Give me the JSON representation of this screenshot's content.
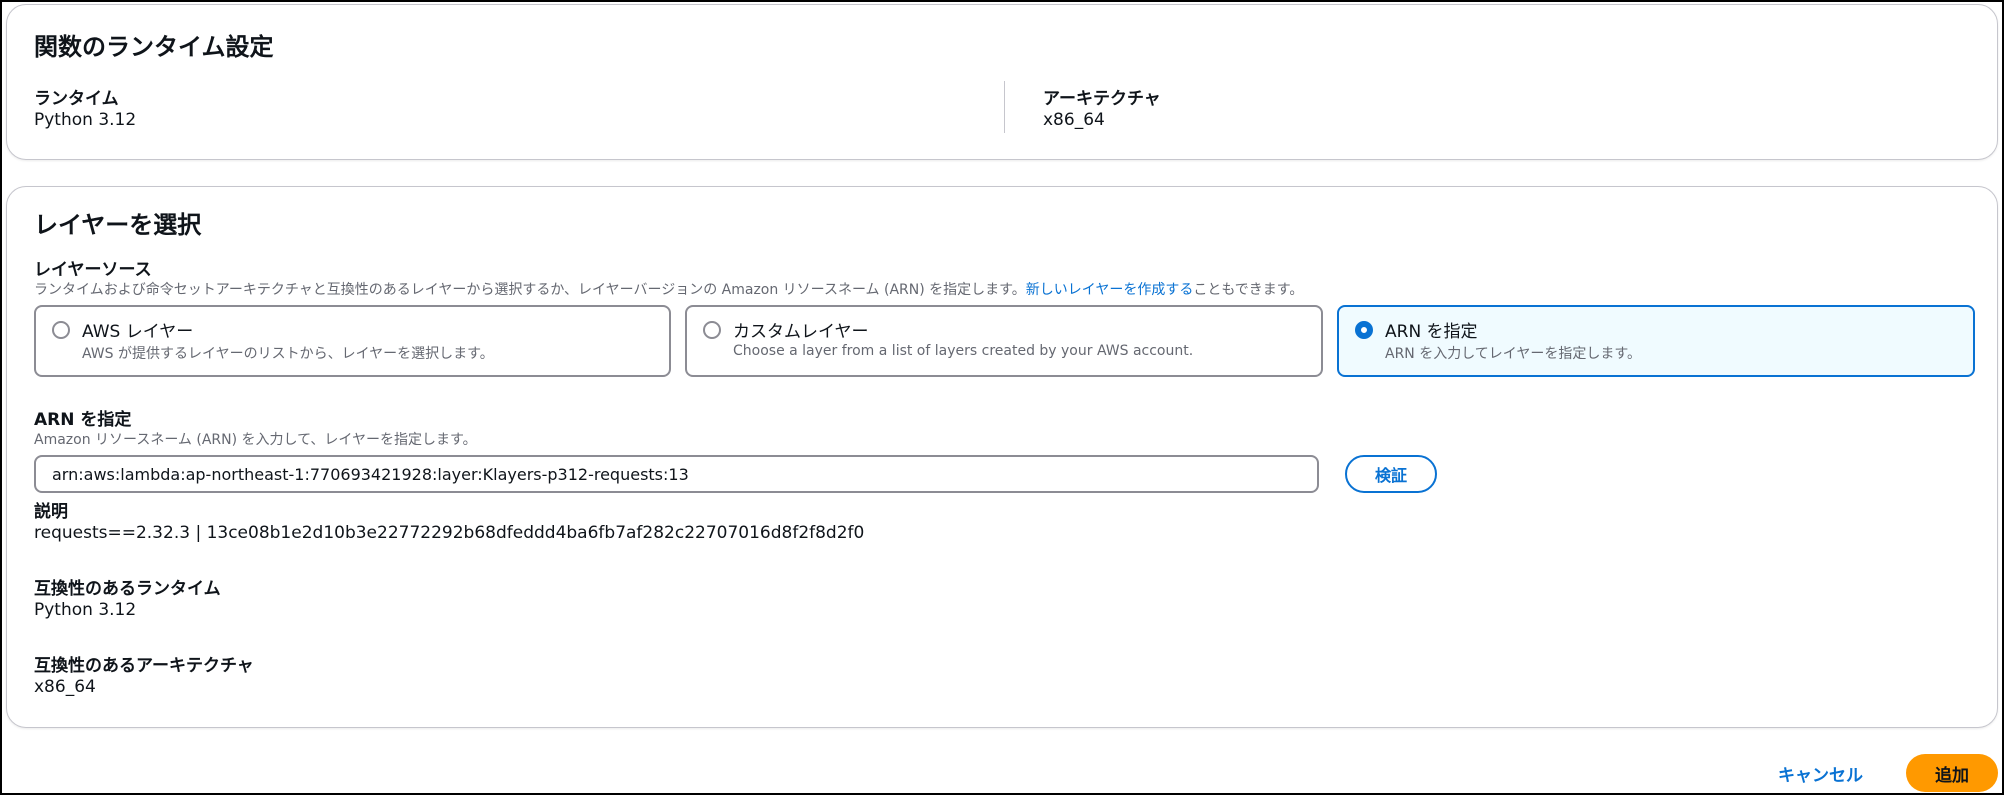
{
  "runtime_settings": {
    "title": "関数のランタイム設定",
    "runtime_label": "ランタイム",
    "runtime_value": "Python 3.12",
    "architecture_label": "アーキテクチャ",
    "architecture_value": "x86_64"
  },
  "layer_select": {
    "title": "レイヤーを選択",
    "source_label": "レイヤーソース",
    "source_desc_before": "ランタイムおよび命令セットアーキテクチャと互換性のあるレイヤーから選択するか、レイヤーバージョンの Amazon リソースネーム (ARN) を指定します。",
    "source_desc_link": "新しいレイヤーを作成する",
    "source_desc_after": "こともできます。",
    "options": [
      {
        "label": "AWS レイヤー",
        "description": "AWS が提供するレイヤーのリストから、レイヤーを選択します。",
        "selected": false
      },
      {
        "label": "カスタムレイヤー",
        "description": "Choose a layer from a list of layers created by your AWS account.",
        "selected": false
      },
      {
        "label": "ARN を指定",
        "description": "ARN を入力してレイヤーを指定します。",
        "selected": true
      }
    ],
    "arn_label": "ARN を指定",
    "arn_desc": "Amazon リソースネーム (ARN) を入力して、レイヤーを指定します。",
    "arn_value": "arn:aws:lambda:ap-northeast-1:770693421928:layer:Klayers-p312-requests:13",
    "verify_button": "検証",
    "description_label": "説明",
    "description_value": "requests==2.32.3 | 13ce08b1e2d10b3e22772292b68dfeddd4ba6fb7af282c22707016d8f2f8d2f0",
    "compatible_runtimes_label": "互換性のあるランタイム",
    "compatible_runtimes_value": "Python 3.12",
    "compatible_architectures_label": "互換性のあるアーキテクチャ",
    "compatible_architectures_value": "x86_64"
  },
  "footer": {
    "cancel_button": "キャンセル",
    "add_button": "追加"
  },
  "colors": {
    "accent": "#0972d3",
    "primary_button": "#ff9900",
    "selected_tile_bg": "#f0fbff"
  }
}
